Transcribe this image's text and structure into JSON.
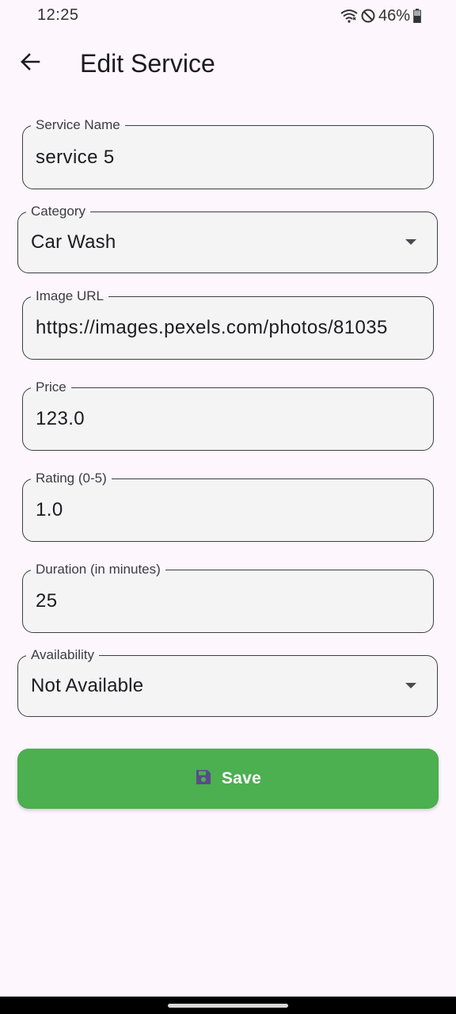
{
  "status_bar": {
    "time": "12:25",
    "battery": "46%",
    "icons": [
      "wifi-icon",
      "do-not-disturb-icon",
      "battery-icon"
    ]
  },
  "app_bar": {
    "title": "Edit Service",
    "back_icon": "arrow-back-icon"
  },
  "form": {
    "service_name": {
      "label": "Service Name",
      "value": "service 5"
    },
    "category": {
      "label": "Category",
      "value": "Car Wash"
    },
    "image_url": {
      "label": "Image URL",
      "value": "https://images.pexels.com/photos/81035"
    },
    "price": {
      "label": "Price",
      "value": "123.0"
    },
    "rating": {
      "label": "Rating (0-5)",
      "value": "1.0"
    },
    "duration": {
      "label": "Duration (in minutes)",
      "value": "25"
    },
    "availability": {
      "label": "Availability",
      "value": "Not Available"
    }
  },
  "save_button": {
    "label": "Save",
    "icon": "save-icon"
  },
  "colors": {
    "background": "#fdf6fd",
    "field_fill": "#f4f4f4",
    "field_border": "#3e3e42",
    "save_button": "#4caf50",
    "save_icon": "#5b4a8b"
  }
}
